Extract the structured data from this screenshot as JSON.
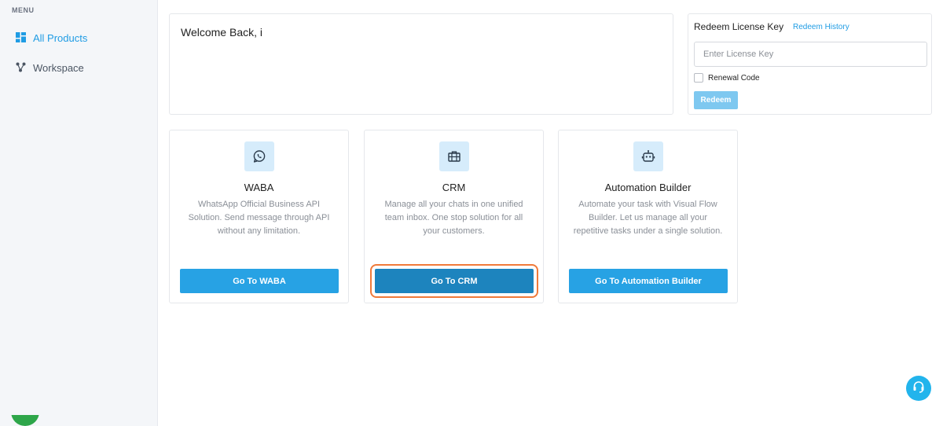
{
  "sidebar": {
    "heading": "MENU",
    "items": [
      {
        "label": "All Products",
        "icon": "grid-icon",
        "active": true
      },
      {
        "label": "Workspace",
        "icon": "workspace-icon",
        "active": false
      }
    ]
  },
  "welcome": {
    "text": "Welcome Back, i"
  },
  "redeem": {
    "title": "Redeem License Key",
    "history_link": "Redeem History",
    "input_placeholder": "Enter License Key",
    "input_value": "",
    "renewal_label": "Renewal Code",
    "renewal_checked": false,
    "button_label": "Redeem"
  },
  "products": [
    {
      "title": "WABA",
      "icon": "whatsapp-icon",
      "description": "WhatsApp Official Business API Solution. Send message through API without any limitation.",
      "button_label": "Go To WABA"
    },
    {
      "title": "CRM",
      "icon": "briefcase-icon",
      "description": "Manage all your chats in one unified team inbox. One stop solution for all your customers.",
      "button_label": "Go To CRM"
    },
    {
      "title": "Automation Builder",
      "icon": "robot-icon",
      "description": "Automate your task with Visual Flow Builder. Let us manage all your repetitive tasks under a single solution.",
      "button_label": "Go To Automation Builder"
    }
  ],
  "colors": {
    "accent": "#27a2e4",
    "focused_button": "#1d84be",
    "focus_ring": "#f07a3a"
  },
  "widgets": {
    "support_icon": "headset-icon",
    "chat_icon": "chat-bubble-icon"
  }
}
